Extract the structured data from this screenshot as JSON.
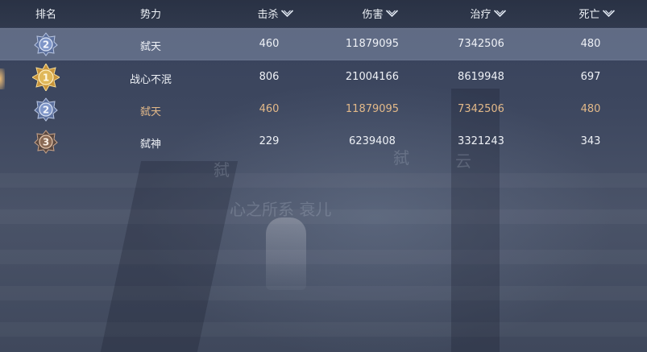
{
  "columns": {
    "rank": "排名",
    "faction": "势力",
    "kills": "击杀",
    "damage": "伤害",
    "healing": "治疗",
    "deaths": "死亡"
  },
  "rows": [
    {
      "rank": "2",
      "faction": "弑天",
      "kills": "460",
      "damage": "11879095",
      "healing": "7342506",
      "deaths": "480"
    },
    {
      "rank": "1",
      "faction": "战心不泯",
      "kills": "806",
      "damage": "21004166",
      "healing": "8619948",
      "deaths": "697"
    },
    {
      "rank": "2",
      "faction": "弑天",
      "kills": "460",
      "damage": "11879095",
      "healing": "7342506",
      "deaths": "480"
    },
    {
      "rank": "3",
      "faction": "弑神",
      "kills": "229",
      "damage": "6239408",
      "healing": "3321243",
      "deaths": "343"
    }
  ],
  "background_text": {
    "line1": "心之所系",
    "line2": "衰儿",
    "mark1": "弑",
    "mark2": "弑",
    "mark3": "云"
  },
  "colors": {
    "own_faction": "#e3b989",
    "selected_row": "#8c9ab3",
    "gold_badge": "#e0b85a",
    "silver_badge": "#7f96c8",
    "bronze_badge": "#8a6a55"
  }
}
